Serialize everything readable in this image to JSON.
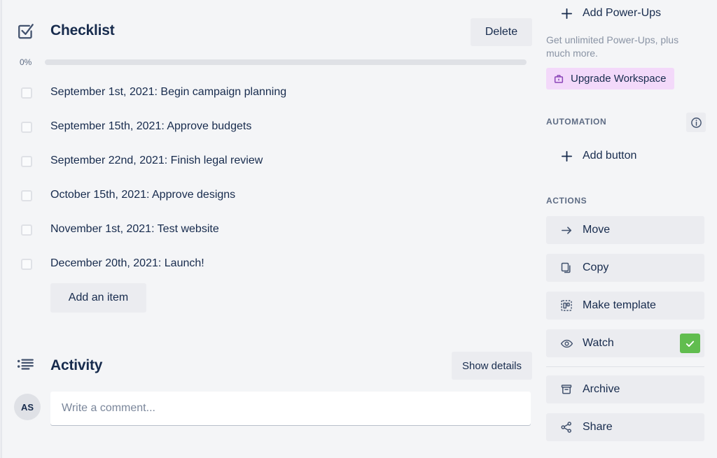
{
  "checklist": {
    "icon": "checkbox-checked-icon",
    "title": "Checklist",
    "delete_label": "Delete",
    "progress_percent_label": "0%",
    "progress_value": 0,
    "add_item_label": "Add an item",
    "items": [
      {
        "label": "September 1st, 2021: Begin campaign planning",
        "checked": false
      },
      {
        "label": "September 15th, 2021: Approve budgets",
        "checked": false
      },
      {
        "label": "September 22nd, 2021: Finish legal review",
        "checked": false
      },
      {
        "label": "October 15th, 2021: Approve designs",
        "checked": false
      },
      {
        "label": "November 1st, 2021: Test website",
        "checked": false
      },
      {
        "label": "December 20th, 2021: Launch!",
        "checked": false
      }
    ]
  },
  "activity": {
    "icon": "activity-list-icon",
    "title": "Activity",
    "show_details_label": "Show details",
    "avatar_initials": "AS",
    "comment_placeholder": "Write a comment...",
    "comment_value": ""
  },
  "sidebar": {
    "add_powerups_label": "Add Power-Ups",
    "powerups_blurb": "Get unlimited Power-Ups, plus much more.",
    "upgrade_label": "Upgrade Workspace",
    "automation_title": "AUTOMATION",
    "add_button_label": "Add button",
    "actions_title": "ACTIONS",
    "actions": [
      {
        "label": "Move",
        "icon": "arrow-right-icon"
      },
      {
        "label": "Copy",
        "icon": "copy-icon"
      },
      {
        "label": "Make template",
        "icon": "template-icon"
      },
      {
        "label": "Watch",
        "icon": "eye-icon",
        "watching": true
      },
      {
        "label": "Archive",
        "icon": "archive-icon"
      },
      {
        "label": "Share",
        "icon": "share-icon"
      }
    ]
  },
  "colors": {
    "page_bg": "#f4f5f7",
    "button_bg": "#ebecf0",
    "text": "#172b4d",
    "muted_text": "#5e6c84",
    "upgrade_bg": "#f3d9fa",
    "watch_green": "#61bd4f",
    "progress_track": "#dfe1e6"
  }
}
